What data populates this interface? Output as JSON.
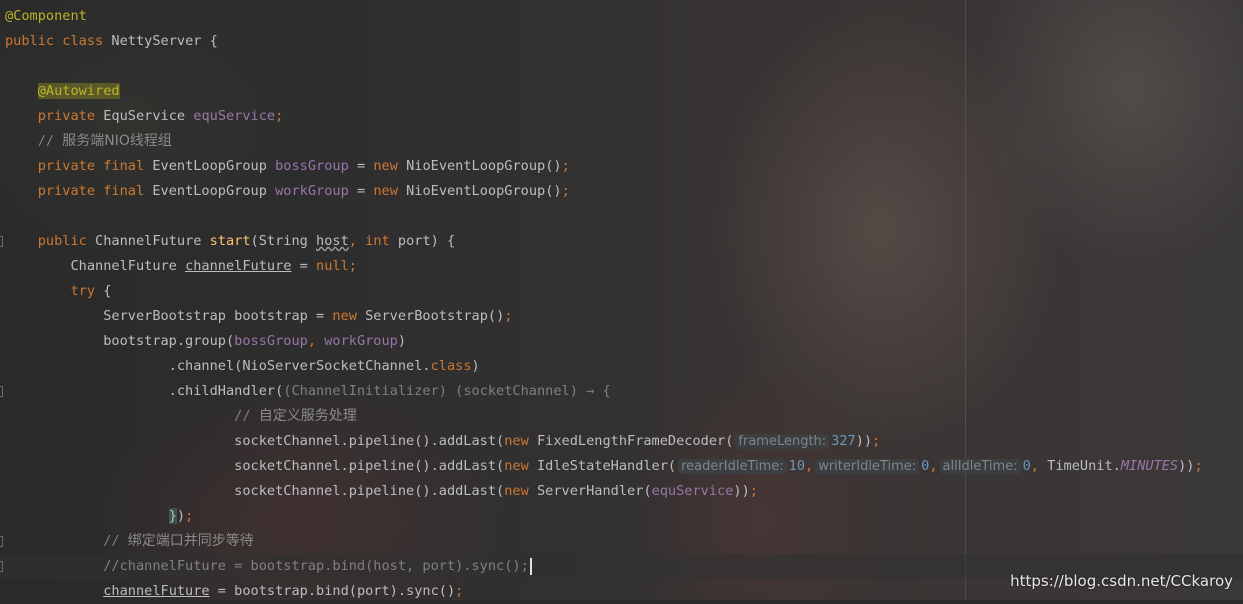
{
  "editor": {
    "lines": [
      {
        "tokens": [
          {
            "t": "@Component",
            "c": "ann"
          }
        ]
      },
      {
        "tokens": [
          {
            "t": "public class ",
            "c": "kw"
          },
          {
            "t": "NettyServer {",
            "c": "txt"
          }
        ]
      },
      {
        "tokens": []
      },
      {
        "tokens": [
          {
            "t": "    ",
            "c": "txt"
          },
          {
            "t": "@Autowired",
            "c": "ann hl"
          }
        ]
      },
      {
        "tokens": [
          {
            "t": "    ",
            "c": "txt"
          },
          {
            "t": "private ",
            "c": "kw"
          },
          {
            "t": "EquService ",
            "c": "txt"
          },
          {
            "t": "equService",
            "c": "fld"
          },
          {
            "t": ";",
            "c": "kw"
          }
        ]
      },
      {
        "tokens": [
          {
            "t": "    // ",
            "c": "cmt"
          },
          {
            "t": "服务端NIO线程组",
            "c": "cmtcn"
          }
        ]
      },
      {
        "tokens": [
          {
            "t": "    ",
            "c": "txt"
          },
          {
            "t": "private final ",
            "c": "kw"
          },
          {
            "t": "EventLoopGroup ",
            "c": "txt"
          },
          {
            "t": "bossGroup",
            "c": "fld"
          },
          {
            "t": " = ",
            "c": "txt"
          },
          {
            "t": "new ",
            "c": "kw"
          },
          {
            "t": "NioEventLoopGroup()",
            "c": "txt"
          },
          {
            "t": ";",
            "c": "kw"
          }
        ]
      },
      {
        "tokens": [
          {
            "t": "    ",
            "c": "txt"
          },
          {
            "t": "private final ",
            "c": "kw"
          },
          {
            "t": "EventLoopGroup ",
            "c": "txt"
          },
          {
            "t": "workGroup",
            "c": "fld"
          },
          {
            "t": " = ",
            "c": "txt"
          },
          {
            "t": "new ",
            "c": "kw"
          },
          {
            "t": "NioEventLoopGroup()",
            "c": "txt"
          },
          {
            "t": ";",
            "c": "kw"
          }
        ]
      },
      {
        "tokens": []
      },
      {
        "gutter": true,
        "tokens": [
          {
            "t": "    ",
            "c": "txt"
          },
          {
            "t": "public ",
            "c": "kw"
          },
          {
            "t": "ChannelFuture ",
            "c": "txt"
          },
          {
            "t": "start",
            "c": "fn"
          },
          {
            "t": "(String ",
            "c": "txt"
          },
          {
            "t": "host",
            "c": "txt wav"
          },
          {
            "t": ", ",
            "c": "kw"
          },
          {
            "t": "int ",
            "c": "kw"
          },
          {
            "t": "port) {",
            "c": "txt"
          }
        ]
      },
      {
        "tokens": [
          {
            "t": "        ChannelFuture ",
            "c": "txt"
          },
          {
            "t": "channelFuture",
            "c": "txt ul"
          },
          {
            "t": " = ",
            "c": "txt"
          },
          {
            "t": "null",
            "c": "kw"
          },
          {
            "t": ";",
            "c": "kw"
          }
        ]
      },
      {
        "tokens": [
          {
            "t": "        ",
            "c": "txt"
          },
          {
            "t": "try ",
            "c": "kw"
          },
          {
            "t": "{",
            "c": "txt"
          }
        ]
      },
      {
        "tokens": [
          {
            "t": "            ServerBootstrap bootstrap = ",
            "c": "txt"
          },
          {
            "t": "new ",
            "c": "kw"
          },
          {
            "t": "ServerBootstrap()",
            "c": "txt"
          },
          {
            "t": ";",
            "c": "kw"
          }
        ]
      },
      {
        "tokens": [
          {
            "t": "            bootstrap.group(",
            "c": "txt"
          },
          {
            "t": "bossGroup",
            "c": "fld"
          },
          {
            "t": ", ",
            "c": "kw"
          },
          {
            "t": "workGroup",
            "c": "fld"
          },
          {
            "t": ")",
            "c": "txt"
          }
        ]
      },
      {
        "tokens": [
          {
            "t": "                    .channel(NioServerSocketChannel.",
            "c": "txt"
          },
          {
            "t": "class",
            "c": "kw"
          },
          {
            "t": ")",
            "c": "txt"
          }
        ]
      },
      {
        "gutter": true,
        "tokens": [
          {
            "t": "                    .childHandler(",
            "c": "txt"
          },
          {
            "t": "(ChannelInitializer) (socketChannel) → {",
            "c": "cmt"
          }
        ]
      },
      {
        "tokens": [
          {
            "t": "                            // ",
            "c": "cmt"
          },
          {
            "t": "自定义服务处理",
            "c": "cmtcn"
          }
        ]
      },
      {
        "tokens": [
          {
            "t": "                            socketChannel.pipeline().addLast(",
            "c": "txt"
          },
          {
            "t": "new ",
            "c": "kw"
          },
          {
            "t": "FixedLengthFrameDecoder(",
            "c": "txt"
          },
          {
            "t": "frameLength:",
            "c": "hint"
          },
          {
            "t": "327",
            "c": "num"
          },
          {
            "t": "))",
            "c": "txt"
          },
          {
            "t": ";",
            "c": "kw"
          }
        ]
      },
      {
        "tokens": [
          {
            "t": "                            socketChannel.pipeline().addLast(",
            "c": "txt"
          },
          {
            "t": "new ",
            "c": "kw"
          },
          {
            "t": "IdleStateHandler(",
            "c": "txt"
          },
          {
            "t": "readerIdleTime:",
            "c": "hint"
          },
          {
            "t": "10",
            "c": "num"
          },
          {
            "t": ",",
            "c": "kw"
          },
          {
            "t": "writerIdleTime:",
            "c": "hint"
          },
          {
            "t": "0",
            "c": "num"
          },
          {
            "t": ",",
            "c": "kw"
          },
          {
            "t": "allIdleTime:",
            "c": "hint"
          },
          {
            "t": "0",
            "c": "num"
          },
          {
            "t": ", ",
            "c": "kw"
          },
          {
            "t": "TimeUnit.",
            "c": "txt"
          },
          {
            "t": "MINUTES",
            "c": "stat"
          },
          {
            "t": "))",
            "c": "txt"
          },
          {
            "t": ";",
            "c": "kw"
          }
        ]
      },
      {
        "tokens": [
          {
            "t": "                            socketChannel.pipeline().addLast(",
            "c": "txt"
          },
          {
            "t": "new ",
            "c": "kw"
          },
          {
            "t": "ServerHandler(",
            "c": "txt"
          },
          {
            "t": "equService",
            "c": "fld"
          },
          {
            "t": "))",
            "c": "txt"
          },
          {
            "t": ";",
            "c": "kw"
          }
        ]
      },
      {
        "tokens": [
          {
            "t": "                    ",
            "c": "txt"
          },
          {
            "t": "}",
            "c": "txt brace-hl"
          },
          {
            "t": ")",
            "c": "txt"
          },
          {
            "t": ";",
            "c": "kw"
          }
        ]
      },
      {
        "gutter": true,
        "tokens": [
          {
            "t": "            // ",
            "c": "cmt"
          },
          {
            "t": "绑定端口并同步等待",
            "c": "cmtcn"
          }
        ]
      },
      {
        "gutter": true,
        "current": true,
        "caret": true,
        "tokens": [
          {
            "t": "            //channelFuture = bootstrap.bind(host, port).sync();",
            "c": "cmt"
          }
        ]
      },
      {
        "tokens": [
          {
            "t": "            ",
            "c": "txt"
          },
          {
            "t": "channelFuture",
            "c": "txt ul"
          },
          {
            "t": " = bootstrap.bind(port).sync()",
            "c": "txt"
          },
          {
            "t": ";",
            "c": "kw"
          }
        ]
      }
    ]
  },
  "watermark": "https://blog.csdn.net/CCkaroy"
}
